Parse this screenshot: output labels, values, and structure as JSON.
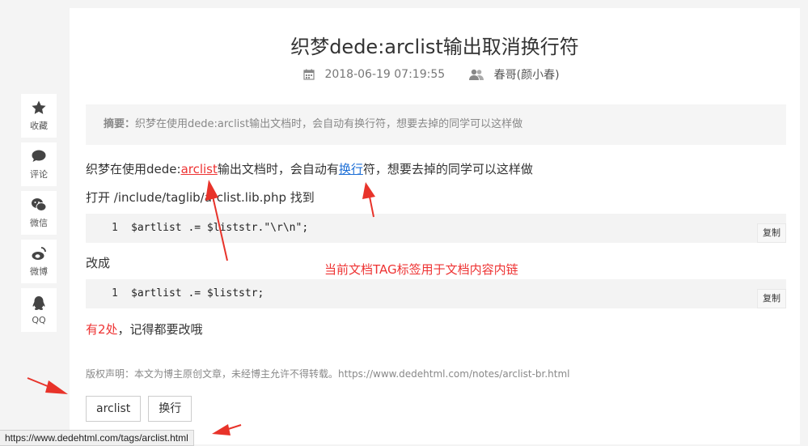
{
  "share": {
    "items": [
      {
        "label": "收藏",
        "icon": "star-icon"
      },
      {
        "label": "评论",
        "icon": "comment-icon"
      },
      {
        "label": "微信",
        "icon": "wechat-icon"
      },
      {
        "label": "微博",
        "icon": "weibo-icon"
      },
      {
        "label": "QQ",
        "icon": "qq-icon"
      }
    ]
  },
  "article": {
    "title": "织梦dede:arclist输出取消换行符",
    "date": "2018-06-19 07:19:55",
    "author": "春哥(颜小春)",
    "summary_label": "摘要：",
    "summary_text": "织梦在使用dede:arclist输出文档时，会自动有换行符，想要去掉的同学可以这样做",
    "intro_pre": "织梦在使用dede:",
    "intro_link1": "arclist",
    "intro_mid": "输出文档时，会自动有",
    "intro_link2": "换行",
    "intro_post": "符，想要去掉的同学可以这样做",
    "step1": "打开 /include/taglib/arclist.lib.php 找到",
    "code1_line": "1",
    "code1": "$artlist .= $liststr.\"\\r\\n\";",
    "step2": "改成",
    "code2_line": "1",
    "code2": "$artlist .= $liststr;",
    "copy_label": "复制",
    "note_red": "有2处",
    "note_rest": "，记得都要改哦",
    "copyright": "版权声明：本文为博主原创文章，未经博主允许不得转载。https://www.dedehtml.com/notes/arclist-br.html",
    "tags": [
      "arclist",
      "换行"
    ]
  },
  "annotation": "当前文档TAG标签用于文档内容内链",
  "status_url": "https://www.dedehtml.com/tags/arclist.html",
  "colors": {
    "accent_red": "#ee3333",
    "link_blue": "#1e6fd6"
  }
}
